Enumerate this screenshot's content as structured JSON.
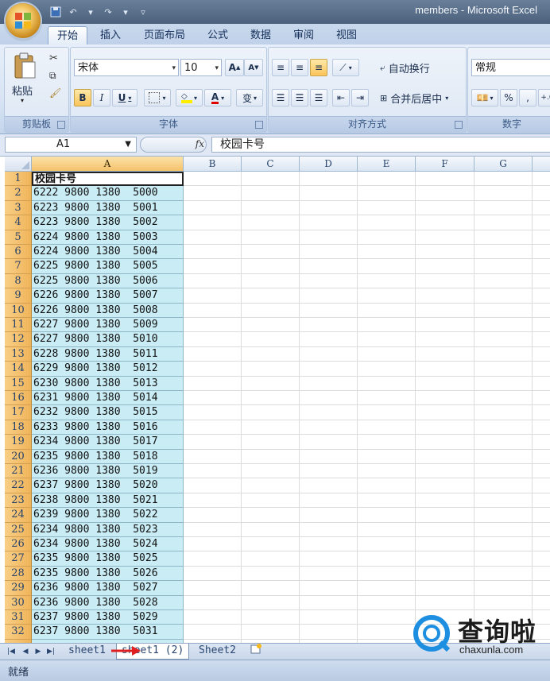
{
  "window": {
    "title": "members - Microsoft Excel"
  },
  "ribbon": {
    "tabs": [
      "开始",
      "插入",
      "页面布局",
      "公式",
      "数据",
      "审阅",
      "视图"
    ],
    "active_tab": "开始",
    "clipboard": {
      "paste_label": "粘贴",
      "group_label": "剪贴板"
    },
    "font": {
      "name": "宋体",
      "size": "10",
      "group_label": "字体",
      "bold": "B",
      "italic": "I",
      "underline": "U",
      "grow": "A",
      "shrink": "A",
      "font_color": "A",
      "phonetic": "变"
    },
    "alignment": {
      "wrap_label": "自动换行",
      "merge_label": "合并后居中",
      "group_label": "对齐方式"
    },
    "number": {
      "format": "常规",
      "percent": "%",
      "comma": ",",
      "group_label": "数字"
    }
  },
  "formula_bar": {
    "name_box": "A1",
    "fx_label": "fx",
    "content": "校园卡号"
  },
  "grid": {
    "columns": [
      "A",
      "B",
      "C",
      "D",
      "E",
      "F",
      "G"
    ],
    "selected_column": "A",
    "rows": [
      {
        "n": "1",
        "a": "校园卡号"
      },
      {
        "n": "2",
        "a": "6222 9800 1380  5000"
      },
      {
        "n": "3",
        "a": "6223 9800 1380  5001"
      },
      {
        "n": "4",
        "a": "6223 9800 1380  5002"
      },
      {
        "n": "5",
        "a": "6224 9800 1380  5003"
      },
      {
        "n": "6",
        "a": "6224 9800 1380  5004"
      },
      {
        "n": "7",
        "a": "6225 9800 1380  5005"
      },
      {
        "n": "8",
        "a": "6225 9800 1380  5006"
      },
      {
        "n": "9",
        "a": "6226 9800 1380  5007"
      },
      {
        "n": "10",
        "a": "6226 9800 1380  5008"
      },
      {
        "n": "11",
        "a": "6227 9800 1380  5009"
      },
      {
        "n": "12",
        "a": "6227 9800 1380  5010"
      },
      {
        "n": "13",
        "a": "6228 9800 1380  5011"
      },
      {
        "n": "14",
        "a": "6229 9800 1380  5012"
      },
      {
        "n": "15",
        "a": "6230 9800 1380  5013"
      },
      {
        "n": "16",
        "a": "6231 9800 1380  5014"
      },
      {
        "n": "17",
        "a": "6232 9800 1380  5015"
      },
      {
        "n": "18",
        "a": "6233 9800 1380  5016"
      },
      {
        "n": "19",
        "a": "6234 9800 1380  5017"
      },
      {
        "n": "20",
        "a": "6235 9800 1380  5018"
      },
      {
        "n": "21",
        "a": "6236 9800 1380  5019"
      },
      {
        "n": "22",
        "a": "6237 9800 1380  5020"
      },
      {
        "n": "23",
        "a": "6238 9800 1380  5021"
      },
      {
        "n": "24",
        "a": "6239 9800 1380  5022"
      },
      {
        "n": "25",
        "a": "6234 9800 1380  5023"
      },
      {
        "n": "26",
        "a": "6234 9800 1380  5024"
      },
      {
        "n": "27",
        "a": "6235 9800 1380  5025"
      },
      {
        "n": "28",
        "a": "6235 9800 1380  5026"
      },
      {
        "n": "29",
        "a": "6236 9800 1380  5027"
      },
      {
        "n": "30",
        "a": "6236 9800 1380  5028"
      },
      {
        "n": "31",
        "a": "6237 9800 1380  5029"
      },
      {
        "n": "32",
        "a": "6237 9800 1380  5031"
      }
    ]
  },
  "sheet_tabs": {
    "tabs": [
      "sheet1",
      "sheet1 (2)",
      "Sheet2"
    ],
    "active": "sheet1 (2)"
  },
  "status": {
    "text": "就绪"
  },
  "watermark": {
    "title": "查询啦",
    "url": "chaxunla.com"
  },
  "colors": {
    "accent_selection": "#f5c26a",
    "cell_fill": "#c9ecf5",
    "annotation_arrow": "#e02020",
    "watermark_blue": "#1e8fe0"
  }
}
